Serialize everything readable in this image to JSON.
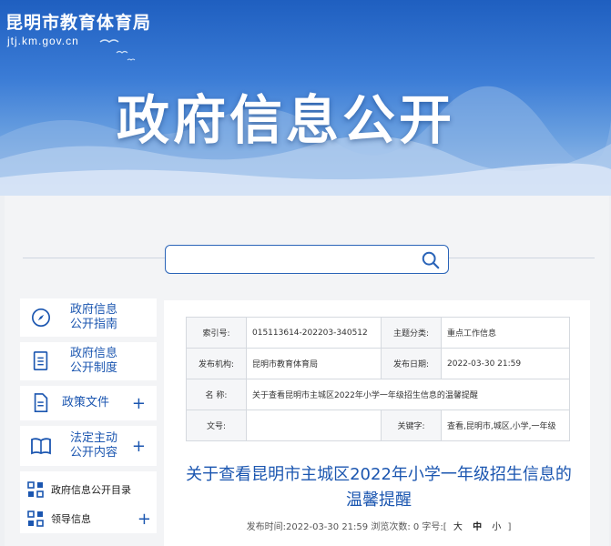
{
  "header": {
    "site_name": "昆明市教育体育局",
    "site_domain": "jtj.km.gov.cn",
    "banner_title": "政府信息公开"
  },
  "search": {
    "placeholder": ""
  },
  "sidebar": {
    "cards": [
      {
        "label": "政府信息公开指南",
        "line1": "政府信息",
        "line2": "公开指南",
        "icon": "compass-icon"
      },
      {
        "label": "政府信息公开制度",
        "line1": "政府信息",
        "line2": "公开制度",
        "icon": "document-icon"
      },
      {
        "label": "政策文件",
        "line1": "政策文件",
        "line2": "",
        "icon": "file-icon",
        "plus": "+"
      },
      {
        "label": "法定主动公开内容",
        "line1": "法定主动",
        "line2": "公开内容",
        "icon": "book-icon",
        "plus": "+"
      }
    ],
    "list": [
      {
        "label": "政府信息公开目录",
        "icon": "grid-icon"
      },
      {
        "label": "领导信息",
        "icon": "grid-icon",
        "plus": "+"
      }
    ]
  },
  "info_table": {
    "index_label": "索引号:",
    "index_value": "015113614-202203-340512",
    "topic_label": "主题分类:",
    "topic_value": "重点工作信息",
    "publisher_label": "发布机构:",
    "publisher_value": "昆明市教育体育局",
    "date_label": "发布日期:",
    "date_value": "2022-03-30 21:59",
    "name_label": "名    称:",
    "name_value": "关于查看昆明市主城区2022年小学一年级招生信息的温馨提醒",
    "docno_label": "文号:",
    "docno_value": "",
    "keywords_label": "关键字:",
    "keywords_value": "查看,昆明市,城区,小学,一年级"
  },
  "article": {
    "title": "关于查看昆明市主城区2022年小学一年级招生信息的温馨提醒",
    "meta_prefix": "发布时间:2022-03-30 21:59 浏览次数: 0 字号:[",
    "font_large": "大",
    "font_medium": "中",
    "font_small": "小",
    "meta_suffix": "]"
  },
  "colors": {
    "primary": "#1b56b0",
    "banner_top": "#1f5fc0",
    "border": "#d5d9df"
  }
}
